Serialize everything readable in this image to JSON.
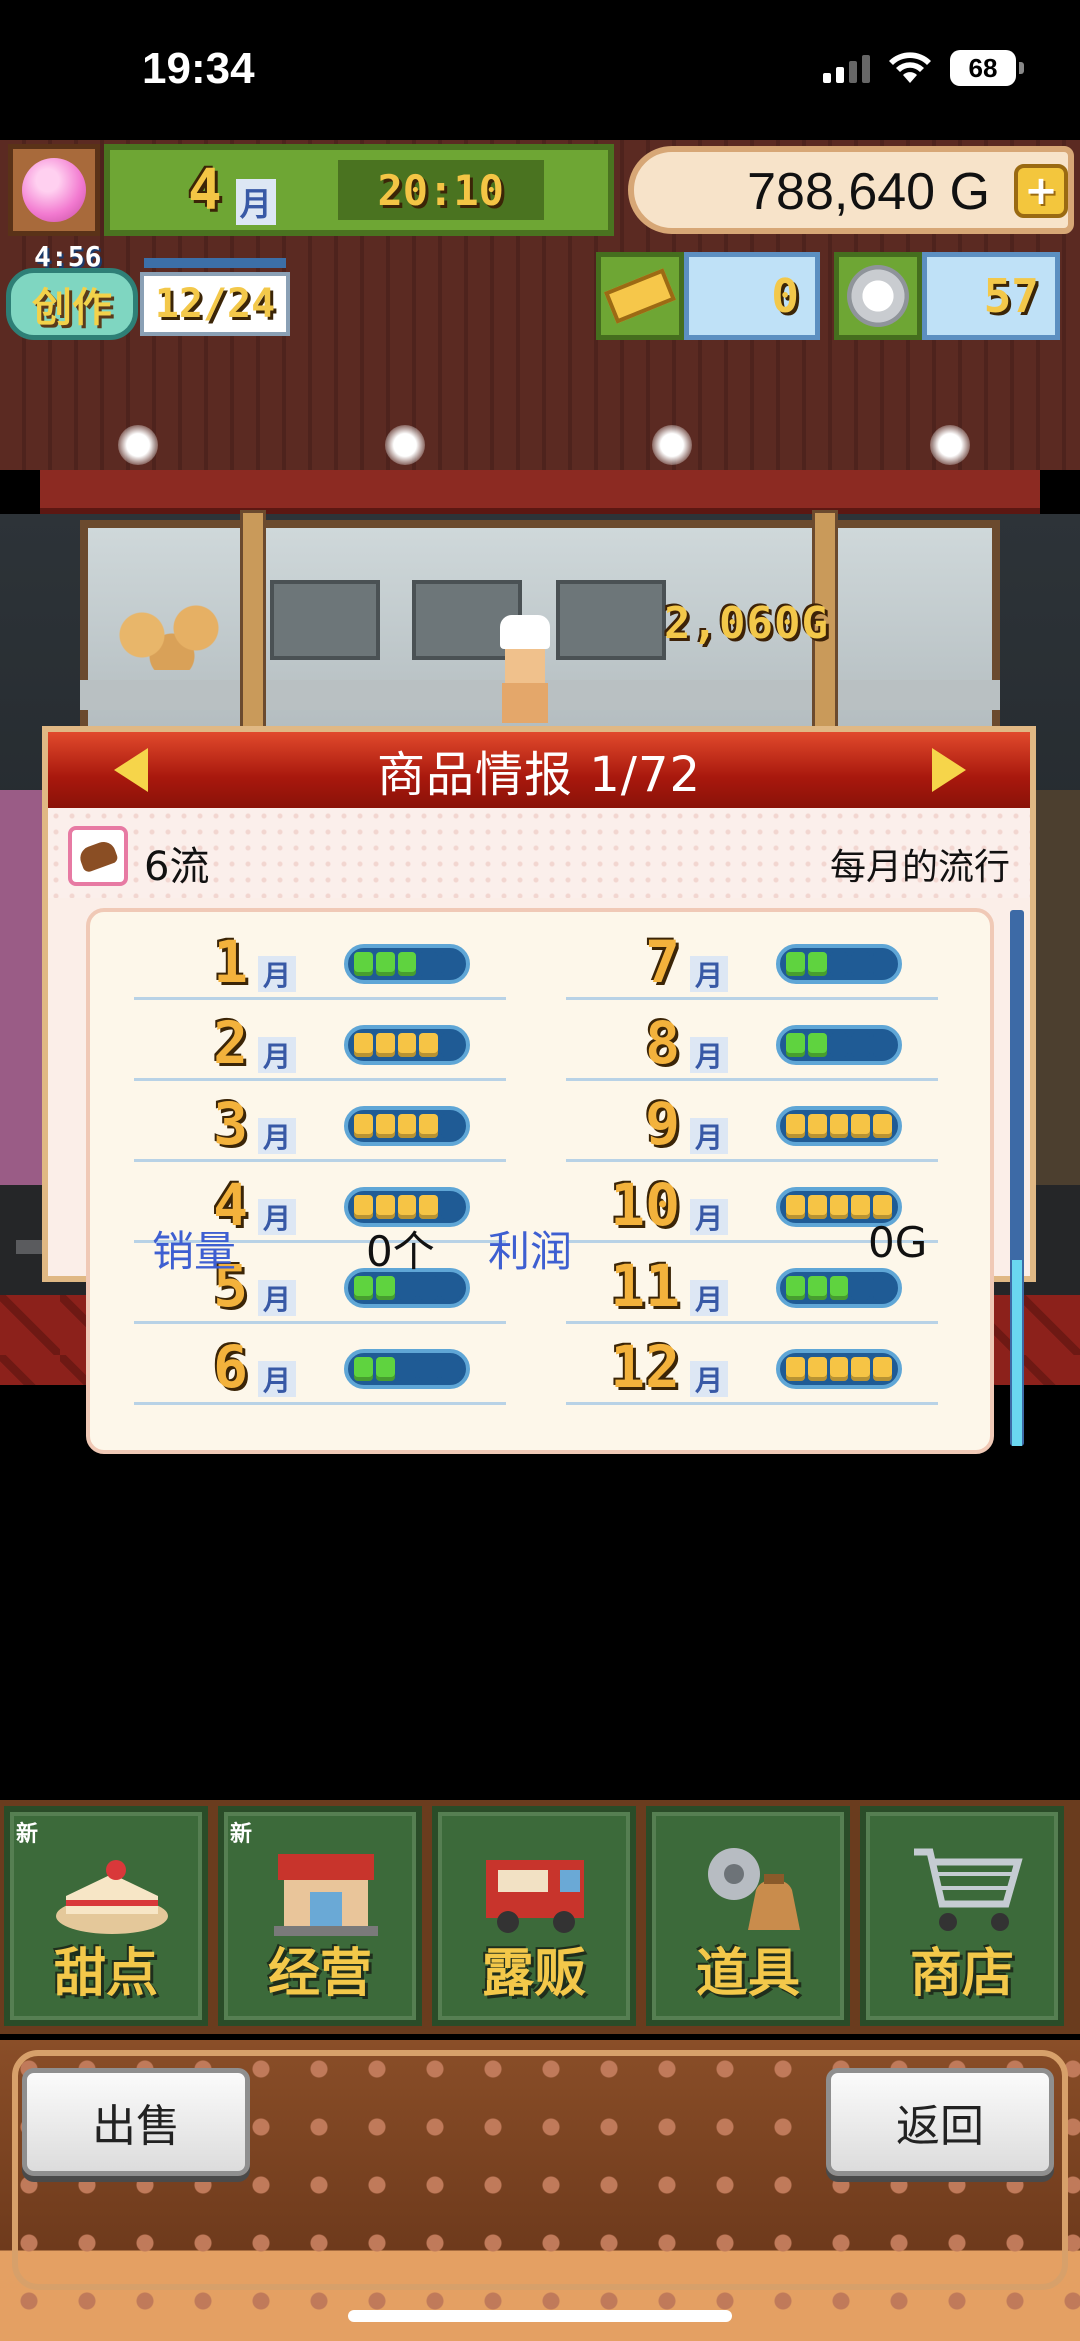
{
  "status_bar": {
    "time": "19:34",
    "battery": "68"
  },
  "hud": {
    "month": "4",
    "month_label": "月",
    "clock": "20:10",
    "money": "788,640 G",
    "plus": "+",
    "create_timer": "4:56",
    "create_label": "创作",
    "create_count": "12/24",
    "gold_count": "0",
    "silver_count": "57"
  },
  "scene": {
    "floating_price": "2,060G"
  },
  "panel": {
    "title": "商品情报 1/72",
    "rank": "6流",
    "trend_title": "每月的流行",
    "month_label": "月",
    "months": [
      {
        "num": "1",
        "level": 3
      },
      {
        "num": "2",
        "level": 4
      },
      {
        "num": "3",
        "level": 4
      },
      {
        "num": "4",
        "level": 4
      },
      {
        "num": "5",
        "level": 2
      },
      {
        "num": "6",
        "level": 2
      },
      {
        "num": "7",
        "level": 2
      },
      {
        "num": "8",
        "level": 2
      },
      {
        "num": "9",
        "level": 5
      },
      {
        "num": "10",
        "level": 5
      },
      {
        "num": "11",
        "level": 3
      },
      {
        "num": "12",
        "level": 5
      }
    ],
    "footer": {
      "sales_label": "销量",
      "sales_value": "0个",
      "profit_label": "利润",
      "profit_value": "0G"
    }
  },
  "menu": [
    {
      "label": "甜点",
      "new": "新"
    },
    {
      "label": "经营",
      "new": "新"
    },
    {
      "label": "露贩",
      "new": ""
    },
    {
      "label": "道具",
      "new": ""
    },
    {
      "label": "商店",
      "new": ""
    }
  ],
  "actions": {
    "sell": "出售",
    "back": "返回"
  },
  "colors": {
    "trend_green": "#5fd33f",
    "trend_yellow": "#f6c445",
    "trend_empty": "#1f5b95"
  }
}
